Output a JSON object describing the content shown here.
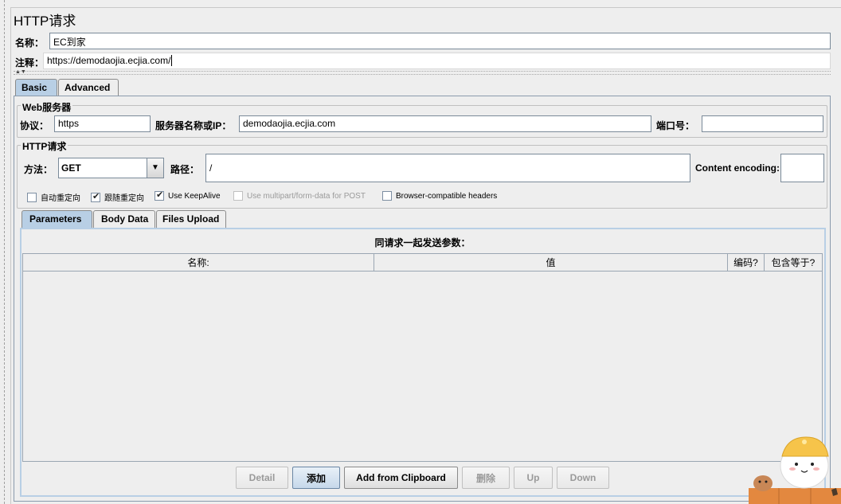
{
  "panel": {
    "title": "HTTP请求"
  },
  "name_row": {
    "label": "名称：",
    "value": "EC到家"
  },
  "comment_row": {
    "label": "注释：",
    "value": "https://demodaojia.ecjia.com/"
  },
  "tabs": [
    {
      "label": "Basic",
      "active": true
    },
    {
      "label": "Advanced",
      "active": false
    }
  ],
  "web_server": {
    "title": "Web服务器",
    "protocol_label": "协议：",
    "protocol_value": "https",
    "server_label": "服务器名称或IP：",
    "server_value": "demodaojia.ecjia.com",
    "port_label": "端口号：",
    "port_value": ""
  },
  "http_request": {
    "title": "HTTP请求",
    "method_label": "方法：",
    "method_value": "GET",
    "path_label": "路径：",
    "path_value": "/",
    "encoding_label": "Content encoding:",
    "encoding_value": ""
  },
  "options": [
    {
      "label": "自动重定向",
      "checked": false,
      "enabled": true
    },
    {
      "label": "跟随重定向",
      "checked": true,
      "enabled": true
    },
    {
      "label": "Use KeepAlive",
      "checked": true,
      "enabled": true
    },
    {
      "label": "Use multipart/form-data for POST",
      "checked": false,
      "enabled": false
    },
    {
      "label": "Browser-compatible headers",
      "checked": false,
      "enabled": true
    }
  ],
  "sub_tabs": [
    {
      "label": "Parameters",
      "active": true
    },
    {
      "label": "Body Data",
      "active": false
    },
    {
      "label": "Files Upload",
      "active": false
    }
  ],
  "params_table": {
    "caption": "同请求一起发送参数：",
    "columns": [
      "名称:",
      "值",
      "编码?",
      "包含等于?"
    ],
    "rows": []
  },
  "buttons": {
    "detail": "Detail",
    "add": "添加",
    "add_clipboard": "Add from Clipboard",
    "delete": "删除",
    "up": "Up",
    "down": "Down"
  },
  "icons": {
    "dropdown": "chevron-down-icon",
    "sticker": "mascot-sticker"
  },
  "colors": {
    "active_tab": "#b8cfe5",
    "background": "#eeeeee",
    "field_border": "#7a8a99"
  }
}
